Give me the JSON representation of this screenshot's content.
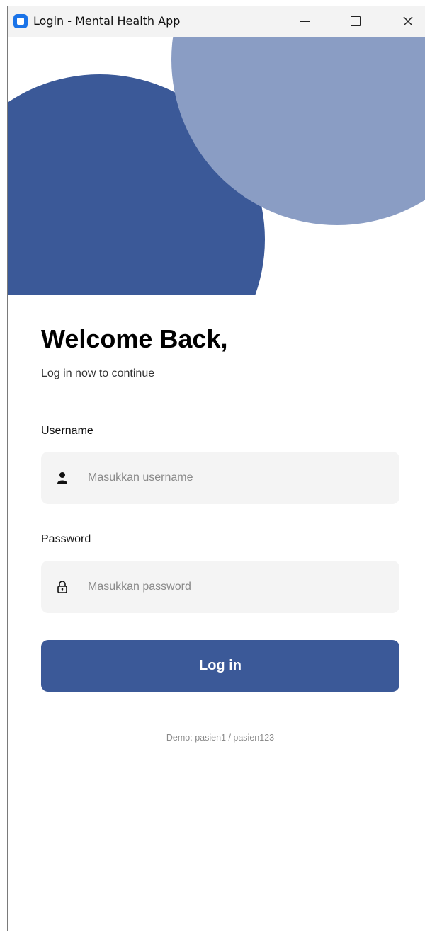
{
  "window": {
    "title": "Login - Mental Health App",
    "icon": "app-icon"
  },
  "colors": {
    "primary": "#3b5998",
    "secondary": "#8a9dc4",
    "input_bg": "#f4f4f4"
  },
  "login": {
    "heading": "Welcome Back,",
    "subheading": "Log in now to continue",
    "username_label": "Username",
    "username_placeholder": "Masukkan username",
    "username_icon": "user-icon",
    "password_label": "Password",
    "password_placeholder": "Masukkan password",
    "password_icon": "lock-icon",
    "button_label": "Log in",
    "demo_hint": "Demo: pasien1 / pasien123"
  }
}
